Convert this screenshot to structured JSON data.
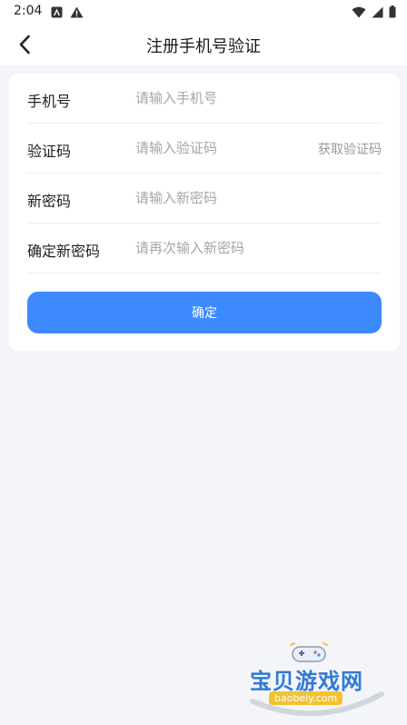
{
  "status_bar": {
    "time": "2:04"
  },
  "header": {
    "title": "注册手机号验证",
    "back_icon": "chevron-left-icon"
  },
  "form": {
    "phone": {
      "label": "手机号",
      "placeholder": "请输入手机号",
      "value": ""
    },
    "code": {
      "label": "验证码",
      "placeholder": "请输入验证码",
      "value": "",
      "get_code_label": "获取验证码"
    },
    "new_password": {
      "label": "新密码",
      "placeholder": "请输入新密码",
      "value": ""
    },
    "confirm_password": {
      "label": "确定新密码",
      "placeholder": "请再次输入新密码",
      "value": ""
    },
    "submit_label": "确定"
  },
  "watermark": {
    "text": "宝贝游戏网",
    "url": "baobeiy.com"
  },
  "colors": {
    "accent": "#3d8aff",
    "background": "#f4f5f9"
  }
}
